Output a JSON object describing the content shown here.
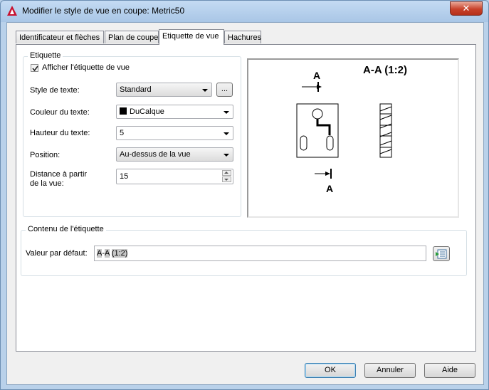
{
  "window": {
    "title": "Modifier le style de vue en coupe: Metric50",
    "close_label": "✕"
  },
  "tabs": [
    {
      "label": "Identificateur et flèches",
      "active": false
    },
    {
      "label": "Plan de coupe",
      "active": false
    },
    {
      "label": "Etiquette de vue",
      "active": true
    },
    {
      "label": "Hachures",
      "active": false
    }
  ],
  "etiquette": {
    "group_title": "Etiquette",
    "show_label_checkbox": {
      "label": "Afficher l'étiquette de vue",
      "checked": true
    },
    "text_style": {
      "label": "Style de texte:",
      "value": "Standard",
      "browse_label": "..."
    },
    "text_color": {
      "label": "Couleur du texte:",
      "value": "DuCalque",
      "swatch_color": "#000000"
    },
    "text_height": {
      "label": "Hauteur du texte:",
      "value": "5"
    },
    "position": {
      "label": "Position:",
      "value": "Au-dessus de la vue"
    },
    "distance": {
      "label_line1": "Distance à partir",
      "label_line2": "de la vue:",
      "value": "15"
    }
  },
  "preview": {
    "view_label": "A-A (1:2)",
    "section_letter_top": "A",
    "section_letter_bottom": "A"
  },
  "contenu": {
    "group_title": "Contenu de l'étiquette",
    "default_value_label": "Valeur par défaut:",
    "value_part1": "A",
    "value_part2": "-",
    "value_part3": "A",
    "value_part4": "(1:2)"
  },
  "buttons": {
    "ok": "OK",
    "cancel": "Annuler",
    "help": "Aide"
  },
  "colors": {
    "accent_red": "#c8412a",
    "titlebar": "#b9d1ea"
  }
}
